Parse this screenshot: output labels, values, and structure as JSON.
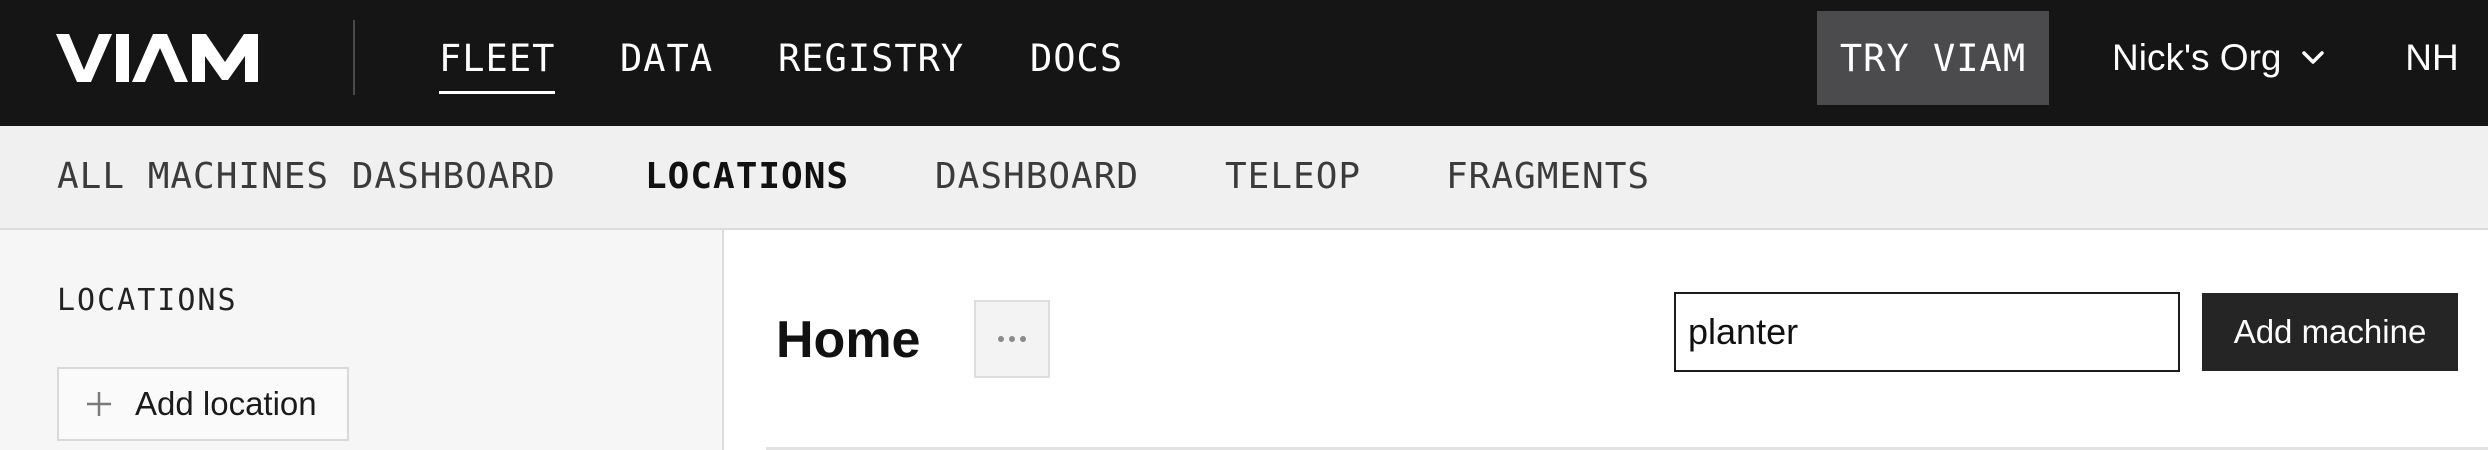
{
  "brand": {
    "logo_text": "VIAM",
    "logo_color": "#ffffff"
  },
  "topnav": {
    "links": [
      {
        "label": "FLEET",
        "active": true
      },
      {
        "label": "DATA",
        "active": false
      },
      {
        "label": "REGISTRY",
        "active": false
      },
      {
        "label": "DOCS",
        "active": false
      }
    ],
    "try_label": "TRY VIAM",
    "org_name": "Nick's Org",
    "org_icon": "chevron-down-icon",
    "avatar_initials": "NH",
    "background": "#151515",
    "try_background": "#4b4b4d"
  },
  "subnav": {
    "tabs": [
      {
        "label": "ALL MACHINES DASHBOARD",
        "active": false
      },
      {
        "label": "LOCATIONS",
        "active": true
      },
      {
        "label": "DASHBOARD",
        "active": false
      },
      {
        "label": "TELEOP",
        "active": false
      },
      {
        "label": "FRAGMENTS",
        "active": false
      }
    ],
    "background": "#f0f0f1"
  },
  "sidebar": {
    "heading": "LOCATIONS",
    "add_location_label": "Add location",
    "add_location_icon": "plus-icon"
  },
  "main": {
    "title": "Home",
    "more_icon": "ellipsis-icon",
    "search_value": "planter",
    "add_machine_label": "Add machine"
  }
}
